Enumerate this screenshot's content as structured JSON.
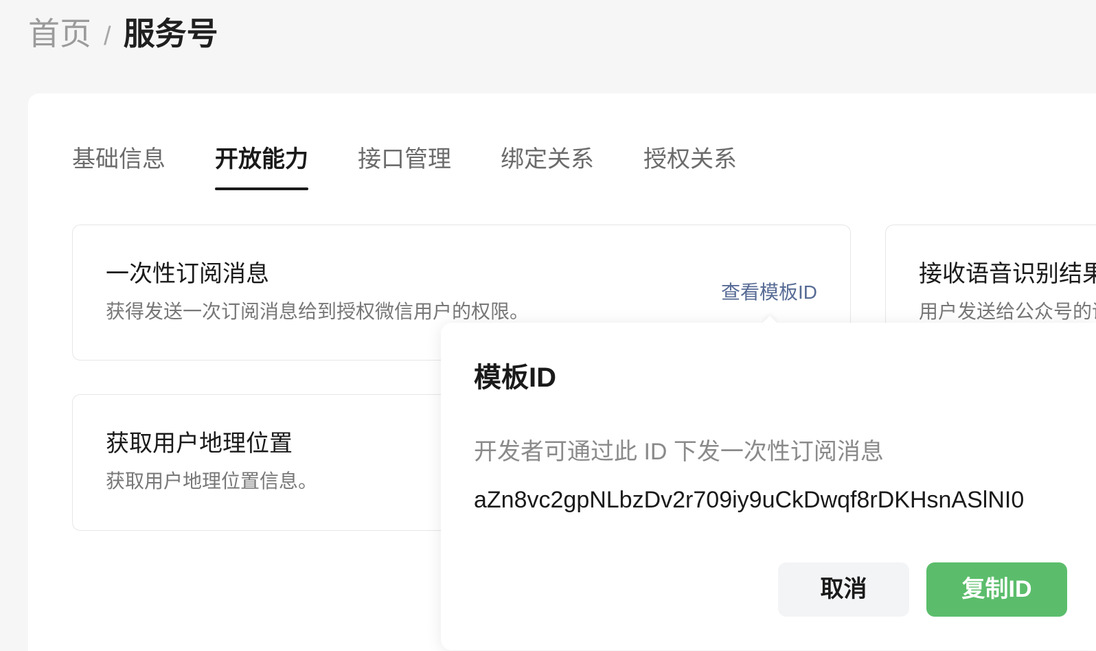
{
  "breadcrumb": {
    "home": "首页",
    "separator": "/",
    "current": "服务号"
  },
  "tabs": [
    {
      "label": "基础信息",
      "active": false
    },
    {
      "label": "开放能力",
      "active": true
    },
    {
      "label": "接口管理",
      "active": false
    },
    {
      "label": "绑定关系",
      "active": false
    },
    {
      "label": "授权关系",
      "active": false
    }
  ],
  "capabilities": [
    {
      "title": "一次性订阅消息",
      "description": "获得发送一次订阅消息给到授权微信用户的权限。",
      "link_label": "查看模板ID"
    },
    {
      "title": "接收语音识别结果",
      "description": "用户发送给公众号的语"
    },
    {
      "title": "获取用户地理位置",
      "description": "获取用户地理位置信息。"
    }
  ],
  "template_popover": {
    "title": "模板ID",
    "description": "开发者可通过此 ID 下发一次性订阅消息",
    "template_id": "aZn8vc2gpNLbzDv2r709iy9uCkDwqf8rDKHsnASlNI0",
    "cancel_label": "取消",
    "copy_label": "复制ID"
  },
  "colors": {
    "accent": "#5bbd6b",
    "link": "#576b95"
  }
}
